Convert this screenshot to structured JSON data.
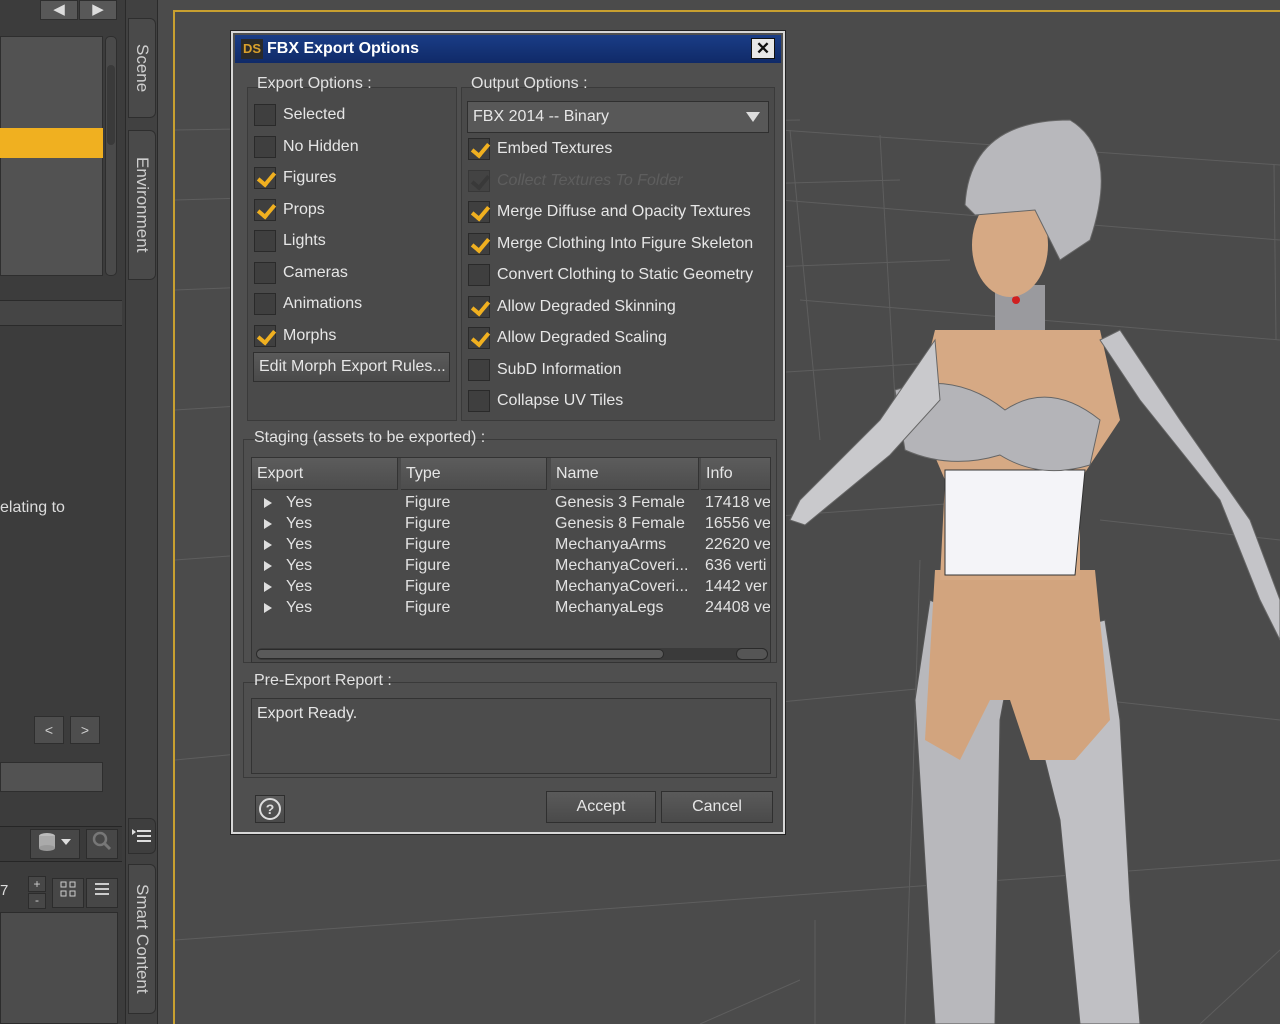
{
  "left_panel": {
    "nav_back": "◀",
    "nav_forward": "▶",
    "partial_text": "elating to",
    "prev_label": "<",
    "next_label": ">",
    "number_label": "7",
    "plus_label": "+",
    "minus_label": "-"
  },
  "side_tabs": {
    "scene": "Scene",
    "environment": "Environment",
    "smart_content": "Smart Content"
  },
  "dialog": {
    "logo": "DS",
    "title": "FBX Export Options",
    "close_label": "✕",
    "export_options": {
      "title": "Export Options :",
      "items": [
        {
          "label": "Selected",
          "checked": false
        },
        {
          "label": "No Hidden",
          "checked": false
        },
        {
          "label": "Figures",
          "checked": true
        },
        {
          "label": "Props",
          "checked": true
        },
        {
          "label": "Lights",
          "checked": false
        },
        {
          "label": "Cameras",
          "checked": false
        },
        {
          "label": "Animations",
          "checked": false
        },
        {
          "label": "Morphs",
          "checked": true
        }
      ],
      "edit_rules_button": "Edit Morph Export Rules..."
    },
    "output_options": {
      "title": "Output Options :",
      "format": "FBX 2014 -- Binary",
      "items": [
        {
          "label": "Embed Textures",
          "checked": true,
          "enabled": true
        },
        {
          "label": "Collect Textures To Folder",
          "checked": true,
          "enabled": false
        },
        {
          "label": "Merge Diffuse and Opacity Textures",
          "checked": true,
          "enabled": true
        },
        {
          "label": "Merge Clothing Into Figure Skeleton",
          "checked": true,
          "enabled": true
        },
        {
          "label": "Convert Clothing to Static Geometry",
          "checked": false,
          "enabled": true
        },
        {
          "label": "Allow Degraded Skinning",
          "checked": true,
          "enabled": true
        },
        {
          "label": "Allow Degraded Scaling",
          "checked": true,
          "enabled": true
        },
        {
          "label": "SubD Information",
          "checked": false,
          "enabled": true
        },
        {
          "label": "Collapse UV Tiles",
          "checked": false,
          "enabled": true
        }
      ]
    },
    "staging": {
      "title": "Staging (assets to be exported) :",
      "columns": [
        "Export",
        "Type",
        "Name",
        "Info"
      ],
      "rows": [
        {
          "export": "Yes",
          "type": "Figure",
          "name": "Genesis 3 Female",
          "info": "17418 ve"
        },
        {
          "export": "Yes",
          "type": "Figure",
          "name": "Genesis 8 Female",
          "info": "16556 ve"
        },
        {
          "export": "Yes",
          "type": "Figure",
          "name": "MechanyaArms",
          "info": "22620 ve"
        },
        {
          "export": "Yes",
          "type": "Figure",
          "name": "MechanyaCoveri...",
          "info": "636 verti"
        },
        {
          "export": "Yes",
          "type": "Figure",
          "name": "MechanyaCoveri...",
          "info": "1442 ver"
        },
        {
          "export": "Yes",
          "type": "Figure",
          "name": "MechanyaLegs",
          "info": "24408 ve"
        }
      ]
    },
    "report": {
      "title": "Pre-Export Report :",
      "text": "Export Ready."
    },
    "help_label": "?",
    "accept_label": "Accept",
    "cancel_label": "Cancel"
  },
  "colors": {
    "accent": "#f0b020",
    "titlebar": "#143478",
    "panel": "#4f4f4f",
    "viewport_border": "#c8a030"
  }
}
